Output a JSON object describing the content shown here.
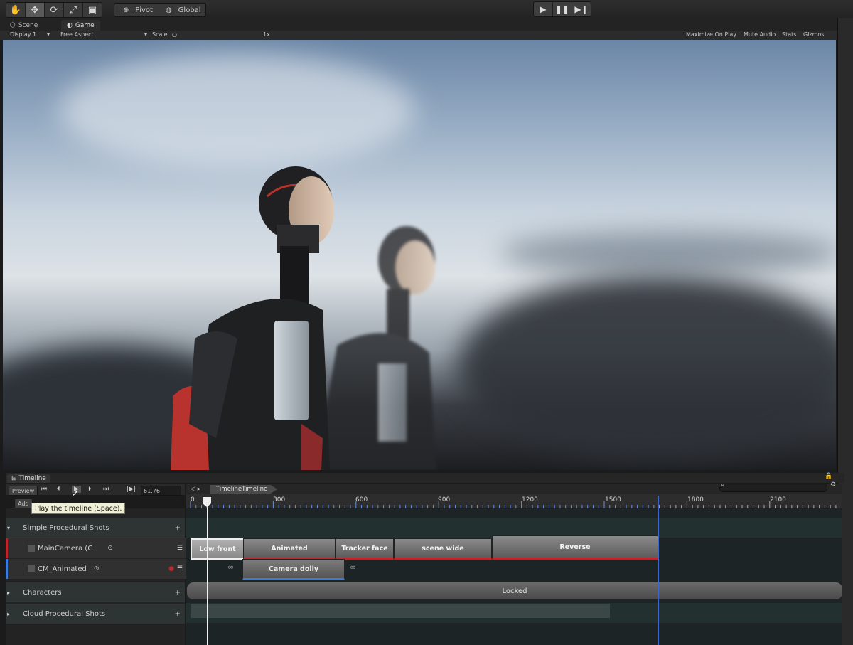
{
  "toolbar": {
    "tools": [
      "hand-icon",
      "move-icon",
      "rotate-icon",
      "scale-icon",
      "rect-icon"
    ],
    "pivot": "Pivot",
    "global": "Global"
  },
  "tabs": [
    {
      "label": "Scene",
      "icon": "scene-icon"
    },
    {
      "label": "Game",
      "icon": "game-icon"
    }
  ],
  "gamebar": {
    "display": "Display 1",
    "aspect": "Free Aspect",
    "scale_label": "Scale",
    "scale_value": "1x",
    "maximize": "Maximize On Play",
    "mute": "Mute Audio",
    "stats": "Stats",
    "gizmos": "Gizmos"
  },
  "timeline": {
    "tab_label": "Timeline",
    "preview": "Preview",
    "time": "61.76",
    "add": "Add",
    "tooltip": "Play the timeline (Space).",
    "asset_name": "TimelineTimeline",
    "ruler": [
      "0",
      "300",
      "600",
      "900",
      "1200",
      "1500",
      "1800",
      "2100"
    ],
    "tracks": {
      "group1": "Simple Procedural Shots",
      "main_camera": "MainCamera (C",
      "cm_animated": "CM_Animated",
      "group2": "Characters",
      "group3": "Cloud Procedural Shots"
    },
    "clips": {
      "low_front": "Low front",
      "animated": "Animated",
      "tracker_face": "Tracker face",
      "scene_wide": "scene wide",
      "reverse": "Reverse",
      "camera_dolly": "Camera dolly",
      "locked": "Locked"
    }
  },
  "colors": {
    "accent_blue": "#3c67c9",
    "clip_red": "#b9262c"
  }
}
